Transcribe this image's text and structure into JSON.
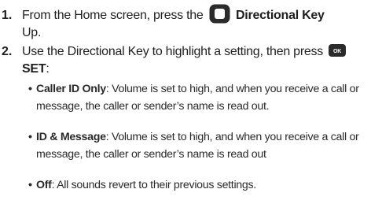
{
  "steps": [
    {
      "number": "1.",
      "text_before": "From the Home screen, press the",
      "key_icon": "directional-key-icon",
      "bold_text": "Directional Key",
      "text_after": "Up."
    },
    {
      "number": "2.",
      "text_before": "Use the Directional Key to highlight a setting, then press",
      "key_icon": "ok-key-icon",
      "key_label": "OK",
      "bold_text": "SET",
      "text_after": ":"
    }
  ],
  "bullets": [
    {
      "term": "Caller ID Only",
      "description": ": Volume is set to high, and when you receive a call or message, the caller or sender’s name is read out."
    },
    {
      "term": "ID & Message",
      "description": ": Volume is set to high, and when you receive a call or message, the caller or sender’s name is read out"
    },
    {
      "term": "Off",
      "description": ": All sounds revert to their previous settings."
    }
  ],
  "bullet_glyph": "•",
  "colors": {
    "text": "#1f1f1f",
    "key_fill": "#2b2b2b"
  }
}
